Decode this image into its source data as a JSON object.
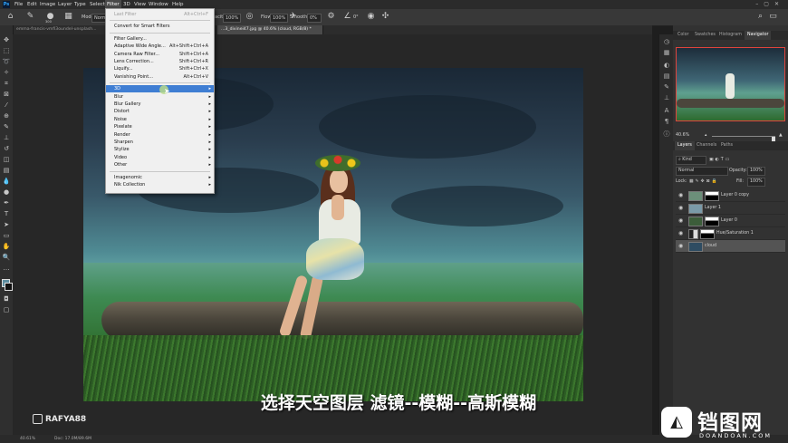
{
  "app": {
    "logo": "Ps"
  },
  "menubar": {
    "items": [
      "File",
      "Edit",
      "Image",
      "Layer",
      "Type",
      "Select",
      "Filter",
      "3D",
      "View",
      "Window",
      "Help"
    ],
    "active": "Filter"
  },
  "options": {
    "mode_label": "Mode:",
    "mode_value": "Normal",
    "opacity_label": "Opacity:",
    "opacity_value": "100%",
    "flow_label": "Flow:",
    "flow_value": "100%",
    "smoothing_label": "Smoothing:",
    "smoothing_value": "0%",
    "angle_value": "0°",
    "brush_size": "300"
  },
  "tabs": [
    {
      "label": "emma-francis-vmfi3oundeI-unsplash...",
      "active": false
    },
    {
      "label": "...3_divinei47.jpg @ 40.6% (cloud, RGB/8) *",
      "active": true
    }
  ],
  "filter_menu": {
    "items": [
      {
        "label": "Last Filter",
        "shortcut": "Alt+Ctrl+F",
        "disabled": true
      },
      {
        "sep": true
      },
      {
        "label": "Convert for Smart Filters"
      },
      {
        "sep": true
      },
      {
        "label": "Filter Gallery..."
      },
      {
        "label": "Adaptive Wide Angle...",
        "shortcut": "Alt+Shift+Ctrl+A"
      },
      {
        "label": "Camera Raw Filter...",
        "shortcut": "Shift+Ctrl+A"
      },
      {
        "label": "Lens Correction...",
        "shortcut": "Shift+Ctrl+R"
      },
      {
        "label": "Liquify...",
        "shortcut": "Shift+Ctrl+X"
      },
      {
        "label": "Vanishing Point...",
        "shortcut": "Alt+Ctrl+V"
      },
      {
        "sep": true
      },
      {
        "label": "3D",
        "submenu": true,
        "highlight": true
      },
      {
        "label": "Blur",
        "submenu": true
      },
      {
        "label": "Blur Gallery",
        "submenu": true
      },
      {
        "label": "Distort",
        "submenu": true
      },
      {
        "label": "Noise",
        "submenu": true
      },
      {
        "label": "Pixelate",
        "submenu": true
      },
      {
        "label": "Render",
        "submenu": true
      },
      {
        "label": "Sharpen",
        "submenu": true
      },
      {
        "label": "Stylize",
        "submenu": true
      },
      {
        "label": "Video",
        "submenu": true
      },
      {
        "label": "Other",
        "submenu": true
      },
      {
        "sep": true
      },
      {
        "label": "Imagenomic",
        "submenu": true
      },
      {
        "label": "Nik Collection",
        "submenu": true
      }
    ]
  },
  "panel": {
    "top_tabs": [
      "Color",
      "Swatches",
      "Histogram",
      "Navigator"
    ],
    "top_active": "Navigator",
    "zoom": "40.6%",
    "layer_tabs": [
      "Layers",
      "Channels",
      "Paths"
    ],
    "layer_active": "Layers",
    "kind_label": "Kind",
    "blend_mode": "Normal",
    "opacity_label": "Opacity:",
    "opacity_value": "100%",
    "lock_label": "Lock:",
    "fill_label": "Fill:",
    "fill_value": "100%",
    "layers": [
      {
        "name": "Layer 0 copy",
        "mask": true
      },
      {
        "name": "Layer 1",
        "mask": false
      },
      {
        "name": "Layer 0",
        "mask": true
      },
      {
        "name": "Hue/Saturation 1",
        "mask": true,
        "adjustment": true
      },
      {
        "name": "cloud",
        "mask": false,
        "selected": true
      }
    ]
  },
  "status": {
    "zoom": "40.61%",
    "doc": "Doc: 17.0M/89.6M"
  },
  "subtitle": "选择天空图层 滤镜--模糊--高斯模糊",
  "watermark_user": "RAFYA88",
  "site_logo": {
    "cn": "铛图网",
    "en": "DOANDOAN.COM"
  },
  "colors": {
    "accent": "#3f7ed3",
    "nav_frame": "#e0443c"
  }
}
